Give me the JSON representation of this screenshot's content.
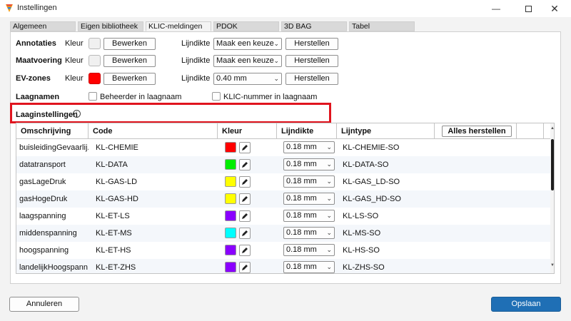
{
  "window": {
    "title": "Instellingen"
  },
  "tabs": [
    "Algemeen",
    "Eigen bibliotheek",
    "KLIC-meldingen",
    "PDOK",
    "3D BAG",
    "Tabel"
  ],
  "settings": {
    "annotaties": {
      "label": "Annotaties",
      "kleur_label": "Kleur",
      "edit_label": "Bewerken",
      "lijndikte_label": "Lijndikte",
      "lijndikte_value": "Maak een keuze",
      "reset_label": "Herstellen",
      "color": "#f0f0f0"
    },
    "maatvoering": {
      "label": "Maatvoering",
      "kleur_label": "Kleur",
      "edit_label": "Bewerken",
      "lijndikte_label": "Lijndikte",
      "lijndikte_value": "Maak een keuze",
      "reset_label": "Herstellen",
      "color": "#f0f0f0"
    },
    "evzones": {
      "label": "EV-zones",
      "kleur_label": "Kleur",
      "edit_label": "Bewerken",
      "lijndikte_label": "Lijndikte",
      "lijndikte_value": "0.40 mm",
      "reset_label": "Herstellen",
      "color": "#ff0000"
    }
  },
  "laagnamen": {
    "label": "Laagnamen",
    "option1": "Beheerder in laagnaam",
    "option2": "KLIC-nummer in laagnaam"
  },
  "laaginstellingen": {
    "title": "Laaginstellingen",
    "info_icon": "info-icon",
    "columns": [
      "Omschrijving",
      "Code",
      "Kleur",
      "Lijndikte",
      "Lijntype"
    ],
    "reset_all_label": "Alles herstellen",
    "rows": [
      {
        "omschrijving": "buisleidingGevaarlij...",
        "code": "KL-CHEMIE",
        "color": "#ff0000",
        "lijndikte": "0.18 mm",
        "lijntype": "KL-CHEMIE-SO"
      },
      {
        "omschrijving": "datatransport",
        "code": "KL-DATA",
        "color": "#00ee00",
        "lijndikte": "0.18 mm",
        "lijntype": "KL-DATA-SO"
      },
      {
        "omschrijving": "gasLageDruk",
        "code": "KL-GAS-LD",
        "color": "#ffff00",
        "lijndikte": "0.18 mm",
        "lijntype": "KL-GAS_LD-SO"
      },
      {
        "omschrijving": "gasHogeDruk",
        "code": "KL-GAS-HD",
        "color": "#ffff00",
        "lijndikte": "0.18 mm",
        "lijntype": "KL-GAS_HD-SO"
      },
      {
        "omschrijving": "laagspanning",
        "code": "KL-ET-LS",
        "color": "#8a00ff",
        "lijndikte": "0.18 mm",
        "lijntype": "KL-LS-SO"
      },
      {
        "omschrijving": "middenspanning",
        "code": "KL-ET-MS",
        "color": "#00ffff",
        "lijndikte": "0.18 mm",
        "lijntype": "KL-MS-SO"
      },
      {
        "omschrijving": "hoogspanning",
        "code": "KL-ET-HS",
        "color": "#8a00ff",
        "lijndikte": "0.18 mm",
        "lijntype": "KL-HS-SO"
      },
      {
        "omschrijving": "landelijkHoogspann...",
        "code": "KL-ET-ZHS",
        "color": "#8a00ff",
        "lijndikte": "0.18 mm",
        "lijntype": "KL-ZHS-SO"
      }
    ]
  },
  "footer": {
    "cancel_label": "Annuleren",
    "save_label": "Opslaan"
  },
  "colors": {
    "accent": "#1f6fb5",
    "highlight": "#e0141e"
  }
}
